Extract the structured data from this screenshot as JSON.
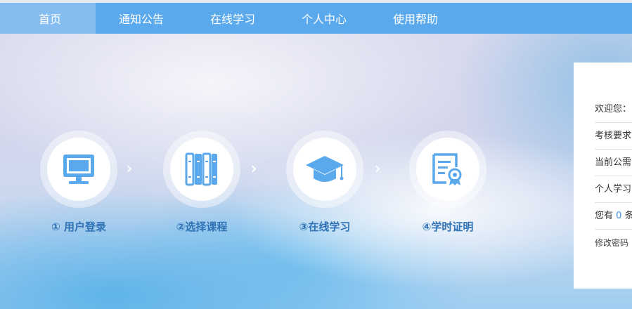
{
  "nav": {
    "items": [
      {
        "label": "首页",
        "active": true
      },
      {
        "label": "通知公告",
        "active": false
      },
      {
        "label": "在线学习",
        "active": false
      },
      {
        "label": "个人中心",
        "active": false
      },
      {
        "label": "使用帮助",
        "active": false
      }
    ]
  },
  "steps": [
    {
      "label": "① 用户登录",
      "icon": "monitor-icon"
    },
    {
      "label": "②选择课程",
      "icon": "books-icon"
    },
    {
      "label": "③在线学习",
      "icon": "graduation-cap-icon"
    },
    {
      "label": "④学时证明",
      "icon": "certificate-icon"
    }
  ],
  "panel": {
    "welcome": "欢迎您：",
    "requirement": "考核要求",
    "current": "当前公需",
    "personal": "个人学习",
    "notice_prefix": "您有",
    "notice_count": "0",
    "notice_suffix": "条",
    "change_password": "修改密码"
  },
  "colors": {
    "nav_bg": "#5aa9ec",
    "nav_active": "#86bdf0",
    "step_icon": "#5aa9ec",
    "step_label": "#2f72b5"
  }
}
